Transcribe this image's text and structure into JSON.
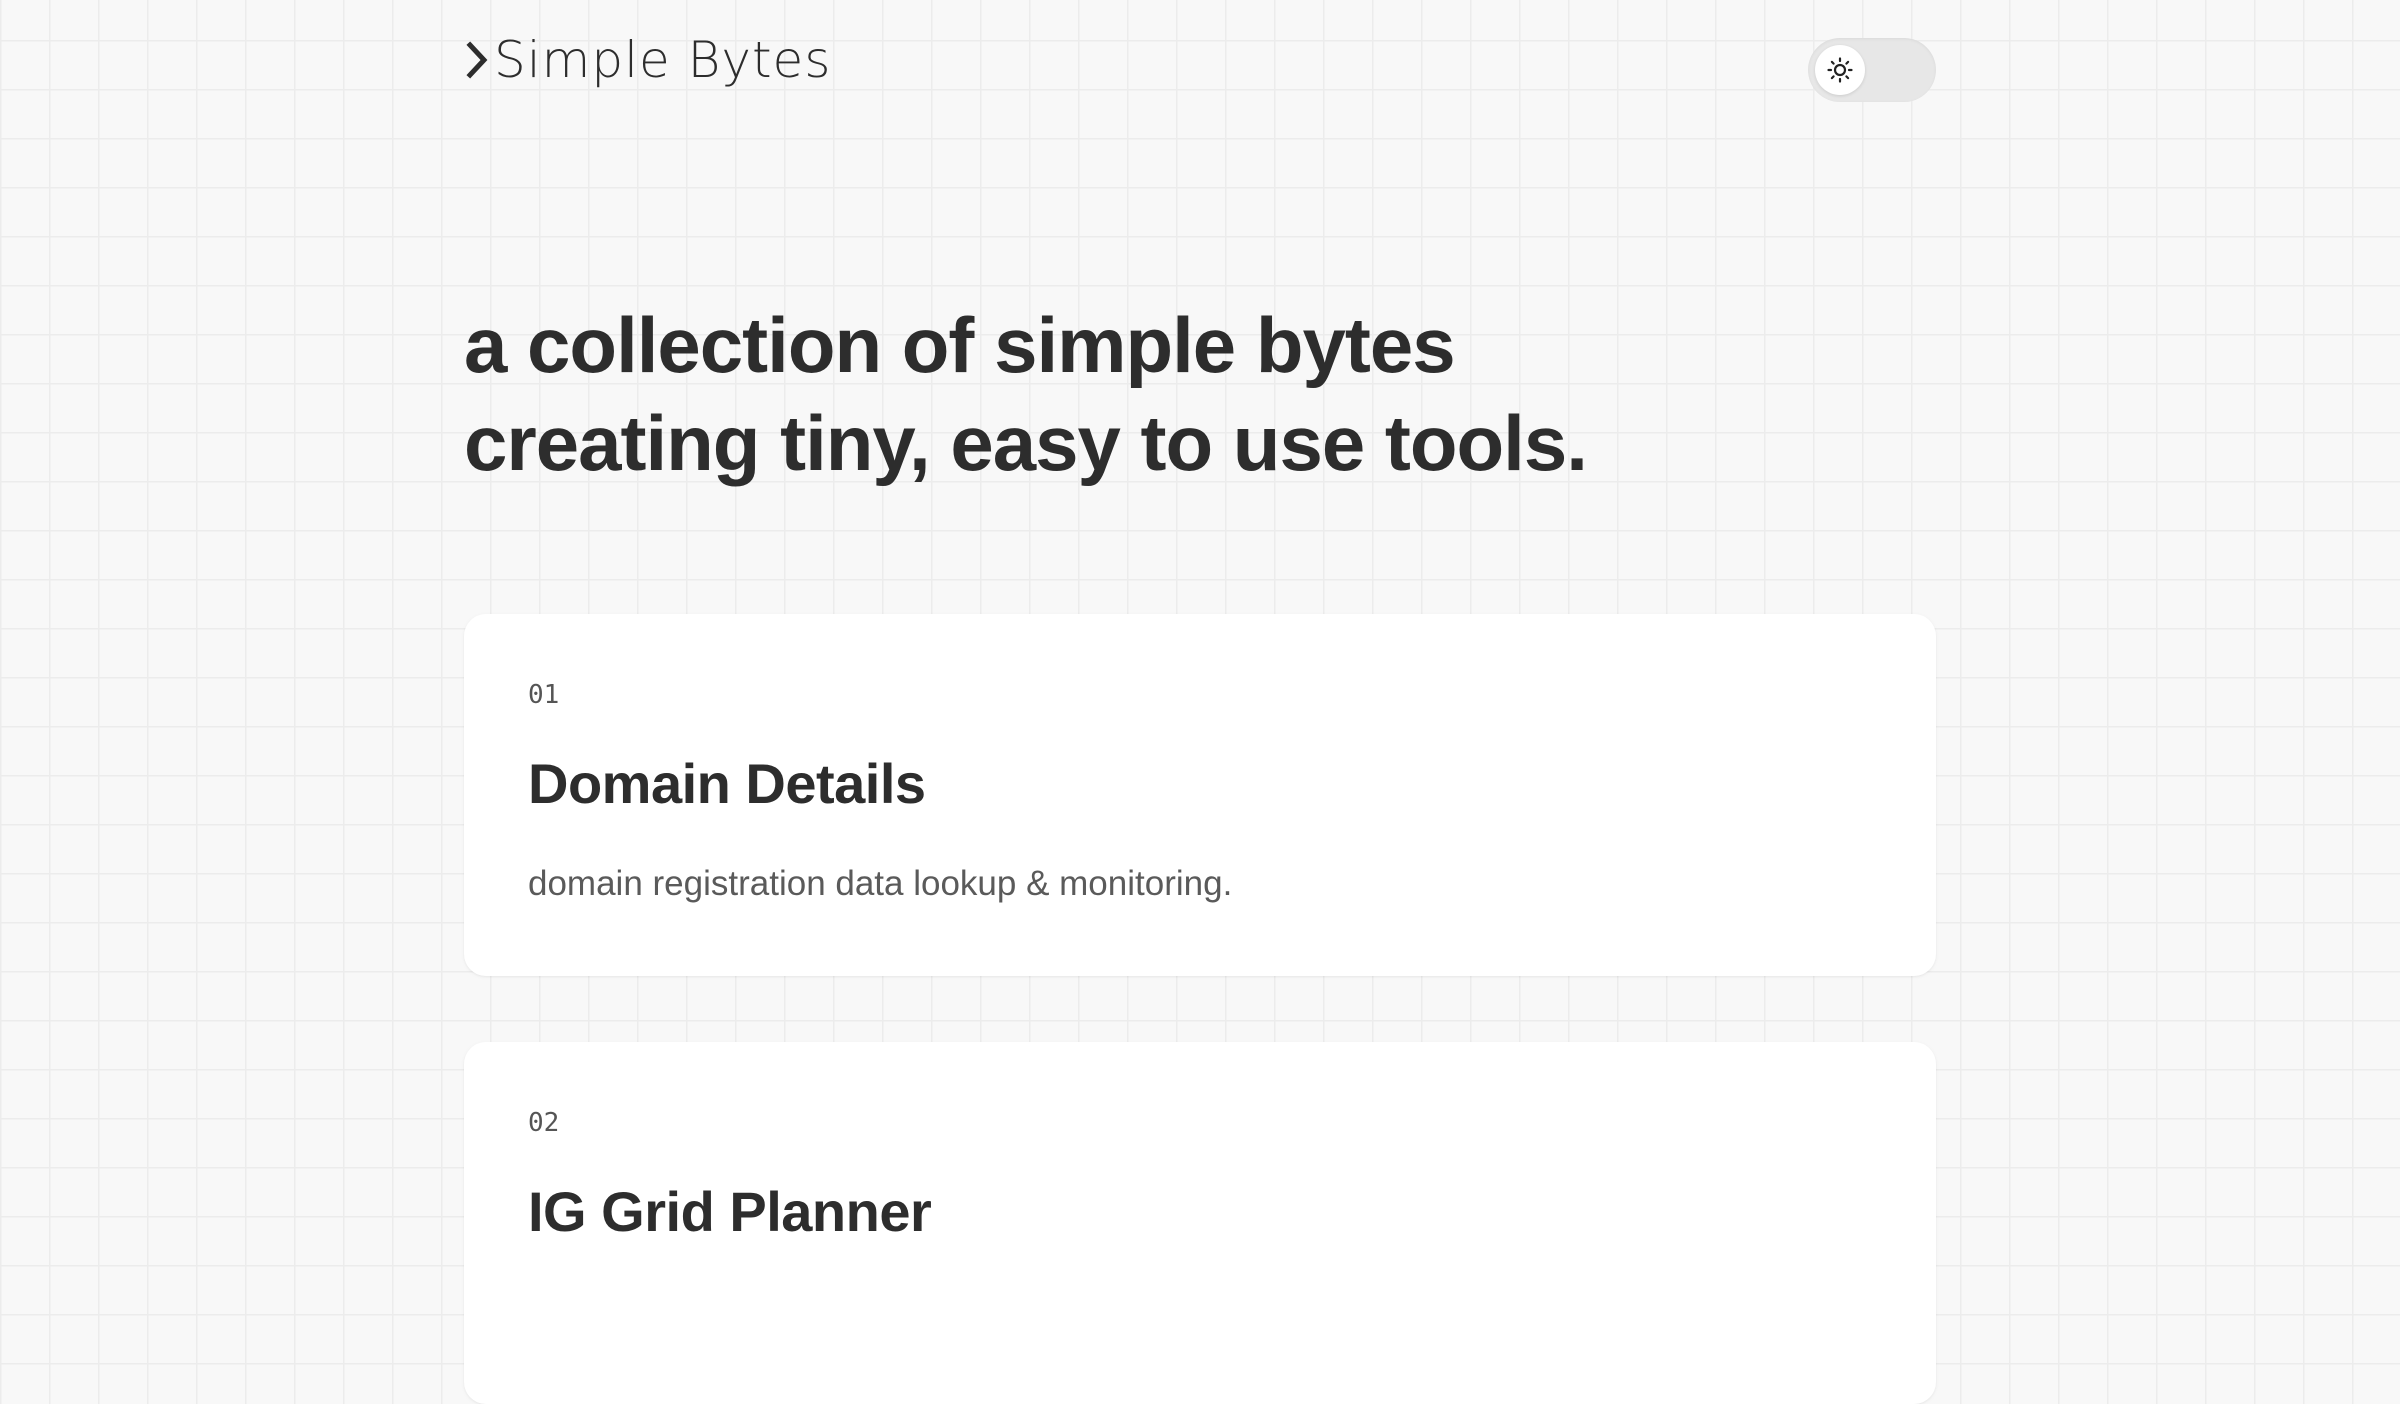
{
  "header": {
    "logo_text": "Simple Bytes",
    "logo_icon": "chevron-right-icon",
    "theme_toggle": {
      "icon": "sun-icon",
      "state": "light"
    }
  },
  "hero": {
    "line1": "a collection of simple bytes",
    "line2": "creating tiny, easy to use tools."
  },
  "tools": [
    {
      "number": "01",
      "title": "Domain Details",
      "description": "domain registration data lookup & monitoring."
    },
    {
      "number": "02",
      "title": "IG Grid Planner",
      "description": ""
    }
  ],
  "colors": {
    "background": "#f8f8f8",
    "grid_line": "#ececec",
    "card": "#ffffff",
    "text_primary": "#2d2d2d",
    "text_secondary": "#5a5a5a",
    "toggle_track": "#e7e7e7"
  }
}
